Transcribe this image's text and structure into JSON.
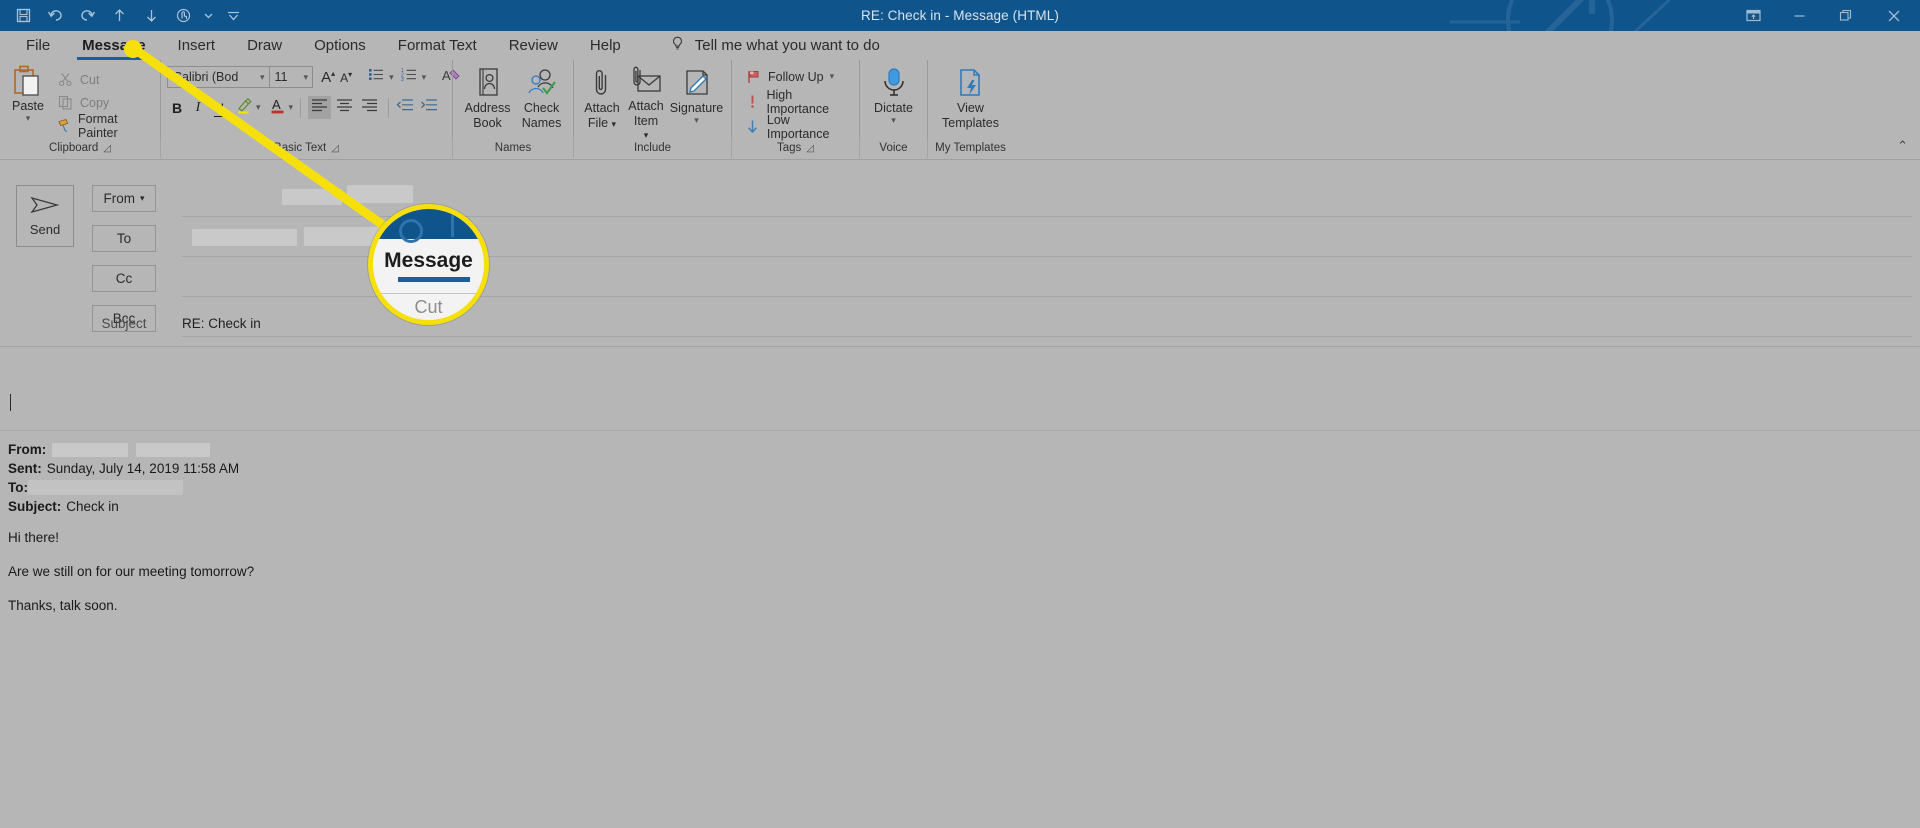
{
  "window": {
    "title": "RE: Check in  -  Message (HTML)",
    "quick_access": [
      {
        "name": "save-icon",
        "label": "Save"
      },
      {
        "name": "undo-icon",
        "label": "Undo"
      },
      {
        "name": "redo-icon",
        "label": "Redo"
      },
      {
        "name": "previous-item-icon",
        "label": "Previous Item"
      },
      {
        "name": "next-item-icon",
        "label": "Next Item"
      },
      {
        "name": "touch-mode-icon",
        "label": "Touch/Mouse Mode"
      },
      {
        "name": "touch-mode-caret-icon",
        "label": "Touch Mode Options"
      },
      {
        "name": "customize-quick-access-toolbar-icon",
        "label": "Customize Quick Access Toolbar"
      }
    ],
    "controls": [
      {
        "name": "ribbon-display-options-button",
        "label": "Ribbon Display Options"
      },
      {
        "name": "minimize-button",
        "label": "Minimize"
      },
      {
        "name": "restore-button",
        "label": "Restore Down"
      },
      {
        "name": "close-button",
        "label": "Close"
      }
    ]
  },
  "tabs": [
    {
      "label": "File",
      "active": false
    },
    {
      "label": "Message",
      "active": true
    },
    {
      "label": "Insert",
      "active": false
    },
    {
      "label": "Draw",
      "active": false
    },
    {
      "label": "Options",
      "active": false
    },
    {
      "label": "Format Text",
      "active": false
    },
    {
      "label": "Review",
      "active": false
    },
    {
      "label": "Help",
      "active": false
    }
  ],
  "tell_me": "Tell me what you want to do",
  "ribbon": {
    "clipboard": {
      "group_label": "Clipboard",
      "paste_label": "Paste",
      "cut_label": "Cut",
      "copy_label": "Copy",
      "format_painter_label": "Format Painter"
    },
    "basic_text": {
      "group_label": "Basic Text",
      "font_name": "Calibri (Bod",
      "font_size": "11",
      "grow_font_label": "A",
      "shrink_font_label": "A",
      "bold_label": "B",
      "italic_label": "I",
      "underline_label": "U",
      "highlight_label": "Text Highlight Color",
      "font_color_label": "Font Color",
      "bullets_label": "Bullets",
      "numbering_label": "Numbering",
      "clear_formatting_label": "Clear All Formatting",
      "align_left_label": "Align Left",
      "align_center_label": "Center",
      "align_right_label": "Align Right",
      "decrease_indent_label": "Decrease Indent",
      "increase_indent_label": "Increase Indent"
    },
    "names": {
      "group_label": "Names",
      "address_book_label": "Address\nBook",
      "address_book_line1": "Address",
      "address_book_line2": "Book",
      "check_names_line1": "Check",
      "check_names_line2": "Names"
    },
    "include": {
      "group_label": "Include",
      "attach_file_line1": "Attach",
      "attach_file_line2": "File",
      "attach_item_line1": "Attach",
      "attach_item_line2": "Item",
      "signature_label": "Signature"
    },
    "tags": {
      "group_label": "Tags",
      "follow_up_label": "Follow Up",
      "high_importance_label": "High Importance",
      "low_importance_label": "Low Importance"
    },
    "voice": {
      "group_label": "Voice",
      "dictate_label": "Dictate"
    },
    "my_templates": {
      "group_label": "My Templates",
      "view_templates_line1": "View",
      "view_templates_line2": "Templates"
    },
    "collapse_ribbon_caret": "⌃"
  },
  "compose": {
    "send_label": "Send",
    "from_label": "From",
    "to_label": "To",
    "cc_label": "Cc",
    "bcc_label": "Bcc",
    "subject_label": "Subject",
    "subject_value": "RE: Check in"
  },
  "message_body": {
    "quoted_header": [
      {
        "label": "From:",
        "value": ""
      },
      {
        "label": "Sent:",
        "value": "Sunday, July 14, 2019 11:58 AM"
      },
      {
        "label": "To:",
        "value": ""
      },
      {
        "label": "Subject:",
        "value": "Check in"
      }
    ],
    "paragraphs": [
      "Hi there!",
      "Are we still on for our meeting tomorrow?",
      "Thanks, talk soon."
    ]
  },
  "callout": {
    "magnified_tab_label": "Message",
    "magnified_secondary_label": "Cut",
    "highlight_color": "#f6e00c"
  },
  "colors": {
    "titlebar": "#10548c",
    "ribbon_bg": "#b6b6b6",
    "accent_blue": "#1d5d9b",
    "highlight_yellow": "#f6e00c",
    "red_flag": "#c0504d"
  }
}
